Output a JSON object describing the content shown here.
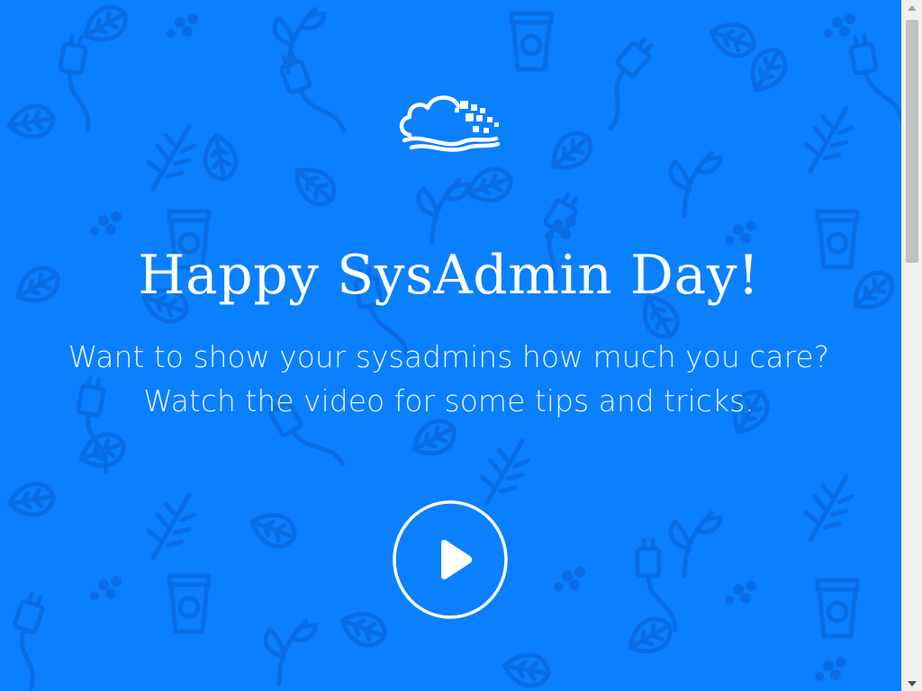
{
  "page": {
    "background_color": "#0a80ff",
    "pattern_color": "#0a6be0"
  },
  "logo": {
    "icon": "cloud-logo-icon"
  },
  "hero": {
    "title": "Happy SysAdmin Day!",
    "subtitle_line1": "Want to show your sysadmins how much you care?",
    "subtitle_line2": "Watch the video for some tips and tricks."
  },
  "video": {
    "play_icon": "play-icon"
  },
  "scrollbar": {
    "up_icon": "scroll-up-arrow-icon",
    "down_icon": "scroll-down-arrow-icon",
    "position_fraction": 0.0
  }
}
